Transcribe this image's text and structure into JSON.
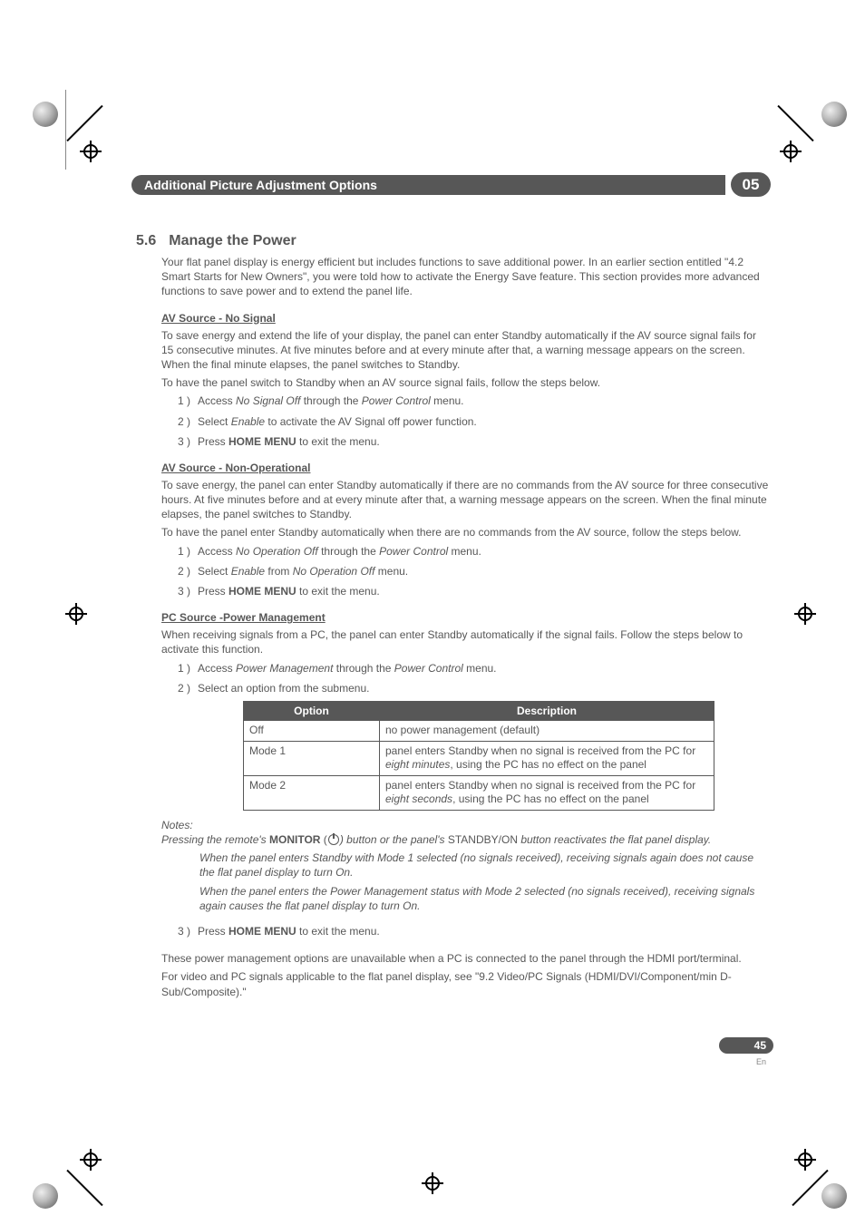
{
  "chapter": {
    "title": "Additional Picture Adjustment Options",
    "number": "05"
  },
  "section": {
    "number": "5.6",
    "title": "Manage the Power"
  },
  "intro": "Your flat panel display is energy efficient but includes functions to save additional power. In an earlier section entitled \"4.2 Smart Starts for New Owners\", you were told how to activate the Energy Save feature. This section provides more advanced functions to save power and to extend the panel life.",
  "av_nosignal": {
    "heading": "AV Source - No Signal",
    "p1": "To save energy and extend the life of your display, the panel can enter Standby automatically if the AV source signal fails for 15 consecutive minutes. At five minutes before and at every minute after that, a warning message appears on the screen. When the final minute elapses, the panel switches to Standby.",
    "p2": "To have the panel switch to Standby when an AV source signal fails, follow the steps below.",
    "steps": {
      "s1a": "Access ",
      "s1b": "No Signal Off",
      "s1c": "  through the ",
      "s1d": "Power Control",
      "s1e": " menu.",
      "s2a": "Select ",
      "s2b": "Enable",
      "s2c": " to activate the AV Signal off power function.",
      "s3a": "Press ",
      "s3b": "HOME MENU",
      "s3c": " to exit the menu."
    }
  },
  "av_nonop": {
    "heading": "AV Source - Non-Operational",
    "p1": "To save energy, the panel can enter Standby automatically if there are no commands from the AV source for three consecutive hours. At five minutes before and at every minute after that, a warning message appears on the screen. When the final minute elapses, the panel switches to Standby.",
    "p2": "To have the panel enter Standby automatically when there are no commands from the AV source, follow the steps below.",
    "steps": {
      "s1a": "Access ",
      "s1b": "No Operation Off",
      "s1c": "  through the ",
      "s1d": "Power Control",
      "s1e": " menu.",
      "s2a": "Select ",
      "s2b": "Enable",
      "s2c": " from ",
      "s2d": "No Operation Off",
      "s2e": " menu.",
      "s3a": "Press ",
      "s3b": "HOME MENU",
      "s3c": " to exit the menu."
    }
  },
  "pc_pm": {
    "heading": "PC Source -Power Management",
    "p1": "When receiving signals from a PC, the panel can enter Standby automatically if the signal fails. Follow the steps below to activate this function.",
    "steps": {
      "s1a": "Access ",
      "s1b": "Power Management",
      "s1c": "  through the ",
      "s1d": "Power Control",
      "s1e": " menu.",
      "s2": "Select an option from the submenu.",
      "s3a": "Press ",
      "s3b": "HOME MENU",
      "s3c": " to exit the menu."
    }
  },
  "table": {
    "h_option": "Option",
    "h_desc": "Description",
    "rows": {
      "r0_opt": "Off",
      "r0_desc": "no power management (default)",
      "r1_opt": "Mode 1",
      "r1_d_a": "panel enters Standby when no signal is received from the PC for ",
      "r1_d_b": "eight minutes",
      "r1_d_c": ", using the PC has no effect on the panel",
      "r2_opt": "Mode 2",
      "r2_d_a": "panel enters Standby when no signal is received from the PC for ",
      "r2_d_b": "eight seconds",
      "r2_d_c": ", using the PC has no effect on the panel"
    }
  },
  "notes": {
    "label": "Notes:",
    "l1a": "Pressing the remote's ",
    "l1b": "MONITOR",
    "l1c": " (",
    "l1d": ") button or the panel's ",
    "l1e": "STANDBY/ON",
    "l1f": " button reactivates the flat panel display.",
    "l2": "When the panel enters Standby with Mode 1 selected (no signals received), receiving signals again does not cause the flat panel display to turn On.",
    "l3": "When the panel enters the Power Management status with Mode 2 selected (no signals received), receiving signals again causes the flat panel display to turn On."
  },
  "footer": {
    "p1": "These power management options are unavailable when a PC is connected to the panel through the HDMI port/terminal.",
    "p2": "For video and PC signals applicable to the flat panel display, see \"9.2 Video/PC Signals (HDMI/DVI/Component/min D-Sub/Composite).\""
  },
  "page": {
    "num": "45",
    "lang": "En"
  },
  "step_labels": {
    "one": "1 )",
    "two": "2 )",
    "three": "3 )"
  }
}
